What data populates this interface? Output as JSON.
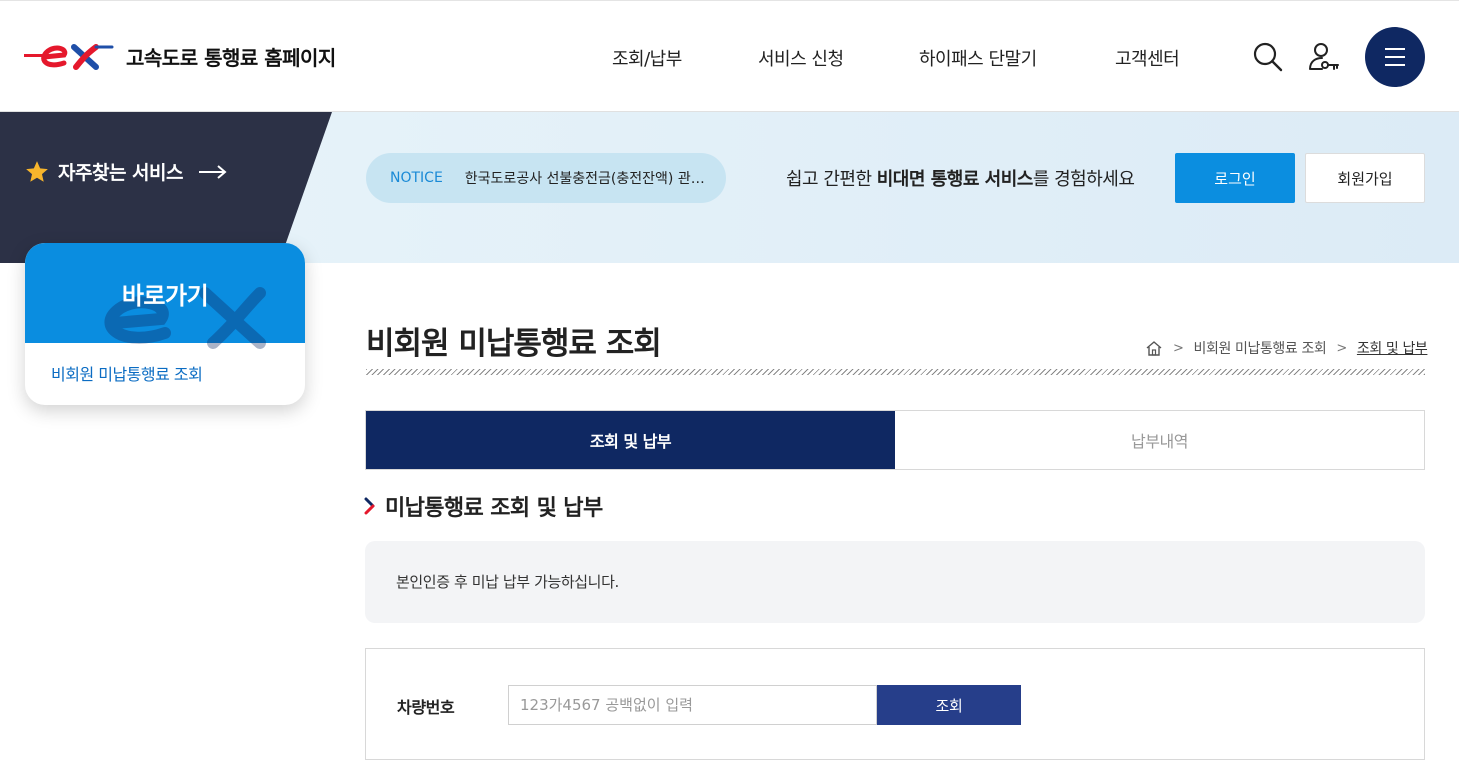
{
  "header": {
    "site_title": "고속도로 통행료 홈페이지",
    "nav": [
      "조회/납부",
      "서비스 신청",
      "하이패스 단말기",
      "고객센터"
    ]
  },
  "visual": {
    "favorites_label": "자주찾는 서비스",
    "notice_tag": "NOTICE",
    "notice_text": "한국도로공사 선불충전금(충전잔액) 관련 안내",
    "promo_pre": "쉽고 간편한 ",
    "promo_bold": "비대면 통행료 서비스",
    "promo_post": "를 경험하세요",
    "login_label": "로그인",
    "join_label": "회원가입"
  },
  "quick": {
    "title": "바로가기",
    "link": "비회원 미납통행료 조회"
  },
  "page": {
    "title": "비회원 미납통행료 조회",
    "breadcrumb": [
      "비회원 미납통행료 조회",
      "조회 및 납부"
    ],
    "tabs": [
      "조회 및 납부",
      "납부내역"
    ],
    "section_title": "미납통행료 조회 및 납부",
    "info_text": "본인인증 후 미납 납부 가능하십니다.",
    "form_label": "차량번호",
    "form_placeholder": "123가4567 공백없이 입력",
    "form_value": "",
    "search_label": "조회"
  },
  "colors": {
    "navy": "#0f2862",
    "accent_blue": "#0b8ee0",
    "button_blue": "#263e8a",
    "logo_red": "#e5182c",
    "logo_blue": "#1f4fa8"
  }
}
